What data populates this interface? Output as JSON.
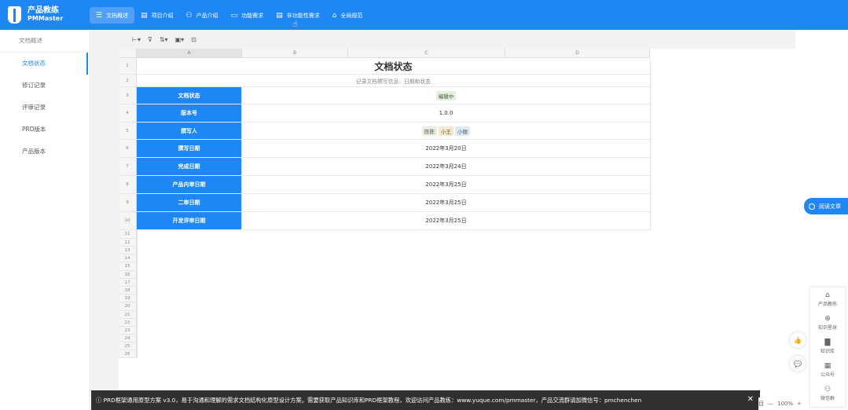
{
  "app": {
    "logo_line1": "产品教练",
    "logo_line2": "PMMaster"
  },
  "nav": [
    {
      "icon": "☰",
      "label": "文档概述"
    },
    {
      "icon": "▤",
      "label": "项目介绍"
    },
    {
      "icon": "⚇",
      "label": "产品介绍"
    },
    {
      "icon": "▭",
      "label": "功能需求"
    },
    {
      "icon": "▤",
      "label": "非功能性需求"
    },
    {
      "icon": "⌂",
      "label": "全局规范"
    }
  ],
  "sidebar": [
    "文档概述",
    "文档状态",
    "修订记录",
    "评审记录",
    "PRD版本",
    "产品版本"
  ],
  "toolbar": [
    "⊢▾",
    "⊽",
    "⇅▾",
    "▣▾",
    "⊡"
  ],
  "columns": [
    "A",
    "B",
    "C",
    "D"
  ],
  "rows": [
    "1",
    "2",
    "3",
    "4",
    "5",
    "6",
    "7",
    "8",
    "9",
    "10",
    "11",
    "12",
    "13",
    "14",
    "15",
    "16",
    "17",
    "18",
    "19",
    "20",
    "21",
    "22",
    "23",
    "24",
    "25",
    "26"
  ],
  "doc": {
    "title": "文档状态",
    "subtitle": "记录文档撰写信息、日期和状态",
    "status_label": "文档状态",
    "status_value": "编辑中",
    "version_label": "版本号",
    "version_value": "1.0.0",
    "author_label": "撰写人",
    "authors": [
      {
        "name": "陈陈",
        "color": "#e8efe0"
      },
      {
        "name": "小王",
        "color": "#f6e9c9"
      },
      {
        "name": "小丽",
        "color": "#dbeaf7"
      }
    ],
    "dates": [
      {
        "label": "撰写日期",
        "value": "2022年3月20日"
      },
      {
        "label": "完成日期",
        "value": "2022年3月24日"
      },
      {
        "label": "产品内审日期",
        "value": "2022年3月25日"
      },
      {
        "label": "二审日期",
        "value": "2022年3月25日"
      },
      {
        "label": "开发评审日期",
        "value": "2022年3月25日"
      }
    ]
  },
  "status_tag_color": "#e3f0db",
  "read_button": "阅读文章",
  "quick": [
    {
      "icon": "⌂",
      "label": "产品教练"
    },
    {
      "icon": "⊕",
      "label": "知识星球"
    },
    {
      "icon": "▇",
      "label": "知识库"
    },
    {
      "icon": "▦",
      "label": "公众号"
    },
    {
      "icon": "⚇",
      "label": "微信群"
    }
  ],
  "fab": [
    "👍",
    "💬"
  ],
  "notice": "ⓘ PRD框架通用原型方案 v3.0，易于沟通和理解的需求文档结构化原型设计方案。需要获取产品知识库和PRD框架教程，欢迎访问产品教练：www.yuque.com/pmmaster，产品交流群请加微信号：pmchenchen",
  "notice_close": "✕",
  "zoom": {
    "minus": "—",
    "value": "100%",
    "plus": "+",
    "extra": "目"
  }
}
